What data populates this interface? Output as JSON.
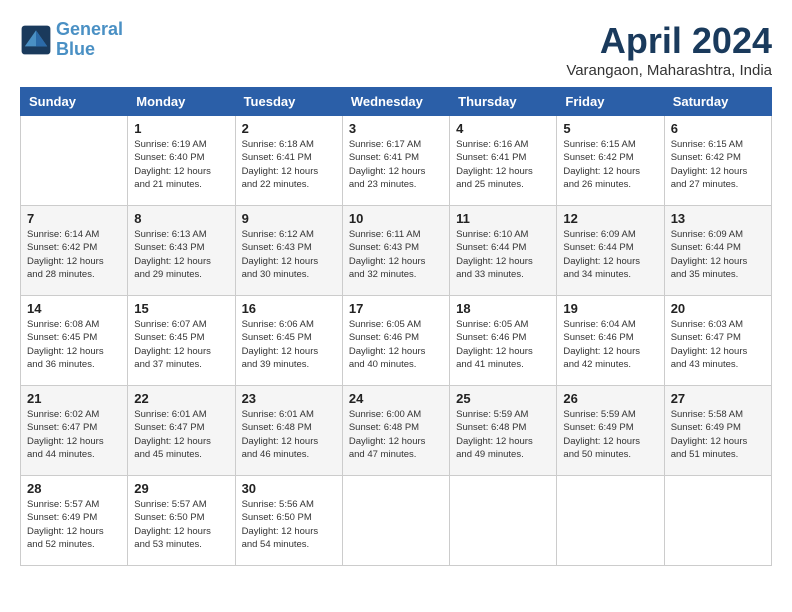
{
  "header": {
    "logo_line1": "General",
    "logo_line2": "Blue",
    "month": "April 2024",
    "location": "Varangaon, Maharashtra, India"
  },
  "days_of_week": [
    "Sunday",
    "Monday",
    "Tuesday",
    "Wednesday",
    "Thursday",
    "Friday",
    "Saturday"
  ],
  "weeks": [
    [
      {
        "day": "",
        "info": ""
      },
      {
        "day": "1",
        "info": "Sunrise: 6:19 AM\nSunset: 6:40 PM\nDaylight: 12 hours\nand 21 minutes."
      },
      {
        "day": "2",
        "info": "Sunrise: 6:18 AM\nSunset: 6:41 PM\nDaylight: 12 hours\nand 22 minutes."
      },
      {
        "day": "3",
        "info": "Sunrise: 6:17 AM\nSunset: 6:41 PM\nDaylight: 12 hours\nand 23 minutes."
      },
      {
        "day": "4",
        "info": "Sunrise: 6:16 AM\nSunset: 6:41 PM\nDaylight: 12 hours\nand 25 minutes."
      },
      {
        "day": "5",
        "info": "Sunrise: 6:15 AM\nSunset: 6:42 PM\nDaylight: 12 hours\nand 26 minutes."
      },
      {
        "day": "6",
        "info": "Sunrise: 6:15 AM\nSunset: 6:42 PM\nDaylight: 12 hours\nand 27 minutes."
      }
    ],
    [
      {
        "day": "7",
        "info": "Sunrise: 6:14 AM\nSunset: 6:42 PM\nDaylight: 12 hours\nand 28 minutes."
      },
      {
        "day": "8",
        "info": "Sunrise: 6:13 AM\nSunset: 6:43 PM\nDaylight: 12 hours\nand 29 minutes."
      },
      {
        "day": "9",
        "info": "Sunrise: 6:12 AM\nSunset: 6:43 PM\nDaylight: 12 hours\nand 30 minutes."
      },
      {
        "day": "10",
        "info": "Sunrise: 6:11 AM\nSunset: 6:43 PM\nDaylight: 12 hours\nand 32 minutes."
      },
      {
        "day": "11",
        "info": "Sunrise: 6:10 AM\nSunset: 6:44 PM\nDaylight: 12 hours\nand 33 minutes."
      },
      {
        "day": "12",
        "info": "Sunrise: 6:09 AM\nSunset: 6:44 PM\nDaylight: 12 hours\nand 34 minutes."
      },
      {
        "day": "13",
        "info": "Sunrise: 6:09 AM\nSunset: 6:44 PM\nDaylight: 12 hours\nand 35 minutes."
      }
    ],
    [
      {
        "day": "14",
        "info": "Sunrise: 6:08 AM\nSunset: 6:45 PM\nDaylight: 12 hours\nand 36 minutes."
      },
      {
        "day": "15",
        "info": "Sunrise: 6:07 AM\nSunset: 6:45 PM\nDaylight: 12 hours\nand 37 minutes."
      },
      {
        "day": "16",
        "info": "Sunrise: 6:06 AM\nSunset: 6:45 PM\nDaylight: 12 hours\nand 39 minutes."
      },
      {
        "day": "17",
        "info": "Sunrise: 6:05 AM\nSunset: 6:46 PM\nDaylight: 12 hours\nand 40 minutes."
      },
      {
        "day": "18",
        "info": "Sunrise: 6:05 AM\nSunset: 6:46 PM\nDaylight: 12 hours\nand 41 minutes."
      },
      {
        "day": "19",
        "info": "Sunrise: 6:04 AM\nSunset: 6:46 PM\nDaylight: 12 hours\nand 42 minutes."
      },
      {
        "day": "20",
        "info": "Sunrise: 6:03 AM\nSunset: 6:47 PM\nDaylight: 12 hours\nand 43 minutes."
      }
    ],
    [
      {
        "day": "21",
        "info": "Sunrise: 6:02 AM\nSunset: 6:47 PM\nDaylight: 12 hours\nand 44 minutes."
      },
      {
        "day": "22",
        "info": "Sunrise: 6:01 AM\nSunset: 6:47 PM\nDaylight: 12 hours\nand 45 minutes."
      },
      {
        "day": "23",
        "info": "Sunrise: 6:01 AM\nSunset: 6:48 PM\nDaylight: 12 hours\nand 46 minutes."
      },
      {
        "day": "24",
        "info": "Sunrise: 6:00 AM\nSunset: 6:48 PM\nDaylight: 12 hours\nand 47 minutes."
      },
      {
        "day": "25",
        "info": "Sunrise: 5:59 AM\nSunset: 6:48 PM\nDaylight: 12 hours\nand 49 minutes."
      },
      {
        "day": "26",
        "info": "Sunrise: 5:59 AM\nSunset: 6:49 PM\nDaylight: 12 hours\nand 50 minutes."
      },
      {
        "day": "27",
        "info": "Sunrise: 5:58 AM\nSunset: 6:49 PM\nDaylight: 12 hours\nand 51 minutes."
      }
    ],
    [
      {
        "day": "28",
        "info": "Sunrise: 5:57 AM\nSunset: 6:49 PM\nDaylight: 12 hours\nand 52 minutes."
      },
      {
        "day": "29",
        "info": "Sunrise: 5:57 AM\nSunset: 6:50 PM\nDaylight: 12 hours\nand 53 minutes."
      },
      {
        "day": "30",
        "info": "Sunrise: 5:56 AM\nSunset: 6:50 PM\nDaylight: 12 hours\nand 54 minutes."
      },
      {
        "day": "",
        "info": ""
      },
      {
        "day": "",
        "info": ""
      },
      {
        "day": "",
        "info": ""
      },
      {
        "day": "",
        "info": ""
      }
    ]
  ]
}
